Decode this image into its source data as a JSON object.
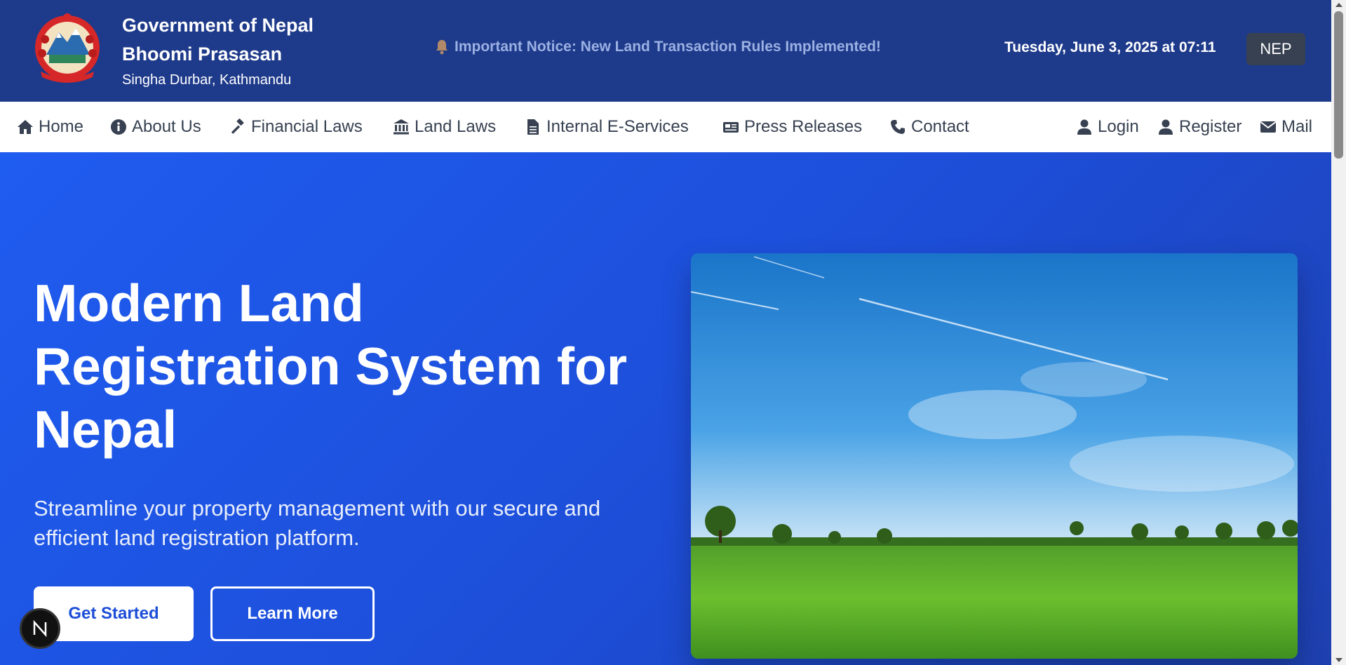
{
  "header": {
    "org_line1": "Government of Nepal",
    "org_line2": "Bhoomi Prasasan",
    "org_line3": "Singha Durbar, Kathmandu",
    "notice": "Important Notice: New Land Transaction Rules Implemented!",
    "datetime": "Tuesday, June 3, 2025 at 07:11",
    "language_button": "NEP"
  },
  "nav": {
    "left": [
      {
        "label": "Home",
        "icon": "home-icon"
      },
      {
        "label": "About Us",
        "icon": "info-circle-icon"
      },
      {
        "label": "Financial Laws",
        "icon": "gavel-icon"
      },
      {
        "label": "Land Laws",
        "icon": "bank-icon"
      },
      {
        "label": "Internal E-Services",
        "icon": "file-icon"
      },
      {
        "label": "Press Releases",
        "icon": "newspaper-icon"
      },
      {
        "label": "Contact",
        "icon": "phone-icon"
      }
    ],
    "right": [
      {
        "label": "Login",
        "icon": "user-icon"
      },
      {
        "label": "Register",
        "icon": "user-icon"
      },
      {
        "label": "Mail",
        "icon": "envelope-icon"
      }
    ]
  },
  "hero": {
    "title": "Modern Land Registration System for Nepal",
    "subtitle": "Streamline your property management with our secure and efficient land registration platform.",
    "primary_button": "Get Started",
    "secondary_button": "Learn More"
  },
  "colors": {
    "header_bg": "#1e3a8a",
    "hero_blue": "#1d4ed8",
    "nav_text": "#374151",
    "notice_text": "#9bb1e3"
  }
}
